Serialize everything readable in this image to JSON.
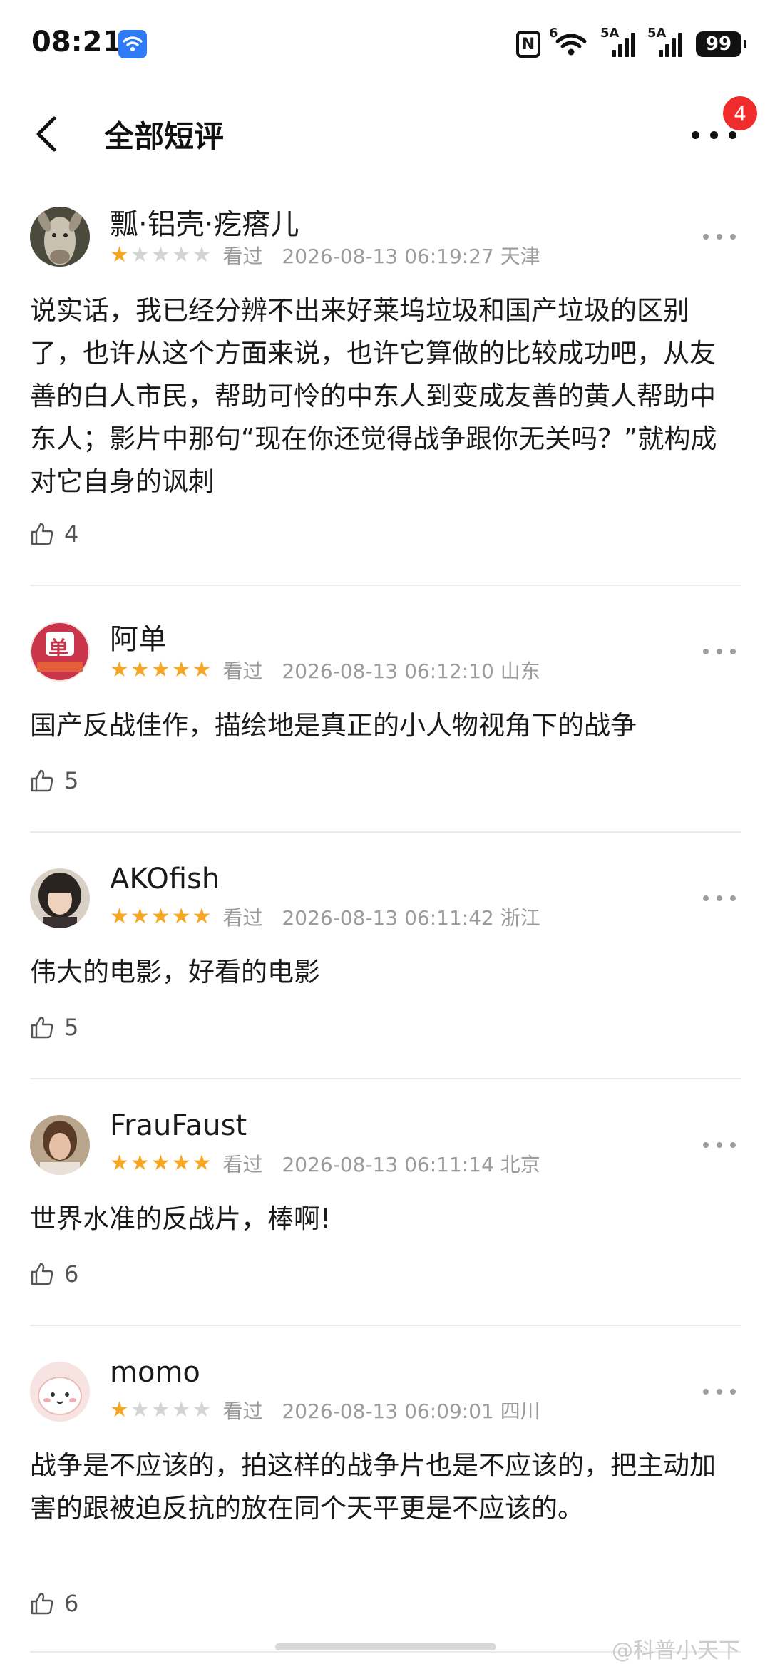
{
  "status_bar": {
    "time": "08:21",
    "signal1_label": "5A",
    "signal2_label": "5A",
    "wifi_label": "6",
    "battery": "99",
    "nfc_label": "N"
  },
  "header": {
    "title": "全部短评",
    "notification_count": "4"
  },
  "reviews": [
    {
      "username": "瓢·铝壳·疙瘩儿",
      "rating": 1,
      "watched": "看过",
      "datetime": "2026-08-13 06:19:27",
      "location": "天津",
      "content": "说实话，我已经分辨不出来好莱坞垃圾和国产垃圾的区别了，也许从这个方面来说，也许它算做的比较成功吧，从友善的白人市民，帮助可怜的中东人到变成友善的黄人帮助中东人；影片中那句“现在你还觉得战争跟你无关吗？”就构成对它自身的讽刺",
      "likes": "4"
    },
    {
      "username": "阿单",
      "rating": 5,
      "watched": "看过",
      "datetime": "2026-08-13 06:12:10",
      "location": "山东",
      "content": "国产反战佳作，描绘地是真正的小人物视角下的战争",
      "likes": "5"
    },
    {
      "username": "AKOfish",
      "rating": 5,
      "watched": "看过",
      "datetime": "2026-08-13 06:11:42",
      "location": "浙江",
      "content": "伟大的电影，好看的电影",
      "likes": "5"
    },
    {
      "username": "FrauFaust",
      "rating": 5,
      "watched": "看过",
      "datetime": "2026-08-13 06:11:14",
      "location": "北京",
      "content": "世界水准的反战片，棒啊!",
      "likes": "6"
    },
    {
      "username": "momo",
      "rating": 1,
      "watched": "看过",
      "datetime": "2026-08-13 06:09:01",
      "location": "四川",
      "content": "战争是不应该的，拍这样的战争片也是不应该的，把主动加害的跟被迫反抗的放在同个天平更是不应该的。",
      "likes": "6"
    }
  ],
  "avatar_texts": {
    "review_2": "单"
  },
  "watermark": "@科普小天下",
  "colors": {
    "star_on": "#f5a623",
    "star_off": "#d4d4d4",
    "badge": "#f02b2b",
    "wifi_badge": "#2f7bf5",
    "meta_text": "#9b9b9b"
  }
}
